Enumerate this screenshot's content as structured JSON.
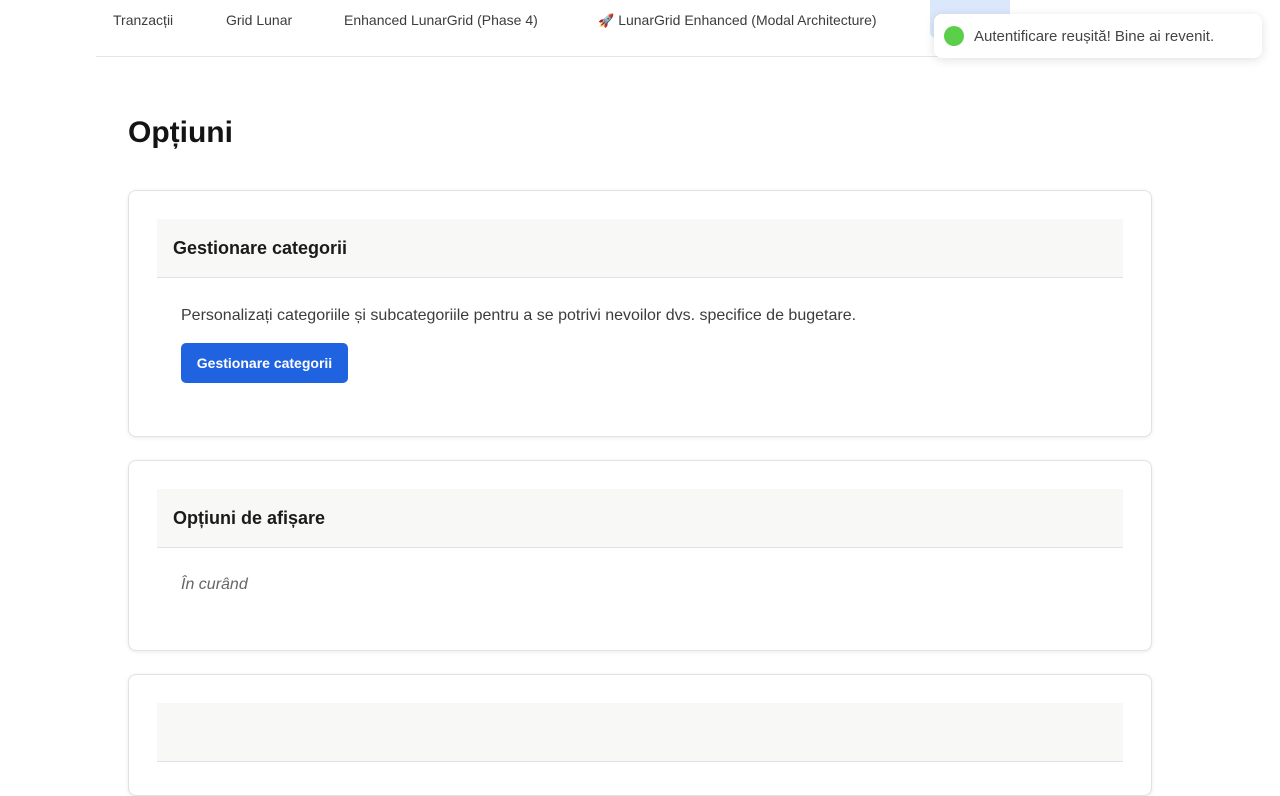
{
  "nav": {
    "items": [
      {
        "label": "Tranzacții"
      },
      {
        "label": "Grid Lunar"
      },
      {
        "label": "Enhanced LunarGrid (Phase 4)"
      },
      {
        "label": "LunarGrid Enhanced (Modal Architecture)",
        "icon": "rocket-icon"
      }
    ],
    "active_color": "#dbe8fb"
  },
  "toast": {
    "message": "Autentificare reușită! Bine ai revenit.",
    "status_color": "#5ccf4a"
  },
  "page": {
    "title": "Opțiuni"
  },
  "cards": {
    "categories": {
      "title": "Gestionare categorii",
      "description": "Personalizați categoriile și subcategoriile pentru a se potrivi nevoilor dvs. specifice de bugetare.",
      "button_label": "Gestionare categorii"
    },
    "display": {
      "title": "Opțiuni de afișare",
      "status": "În curând"
    }
  },
  "colors": {
    "primary": "#1f63e0"
  }
}
